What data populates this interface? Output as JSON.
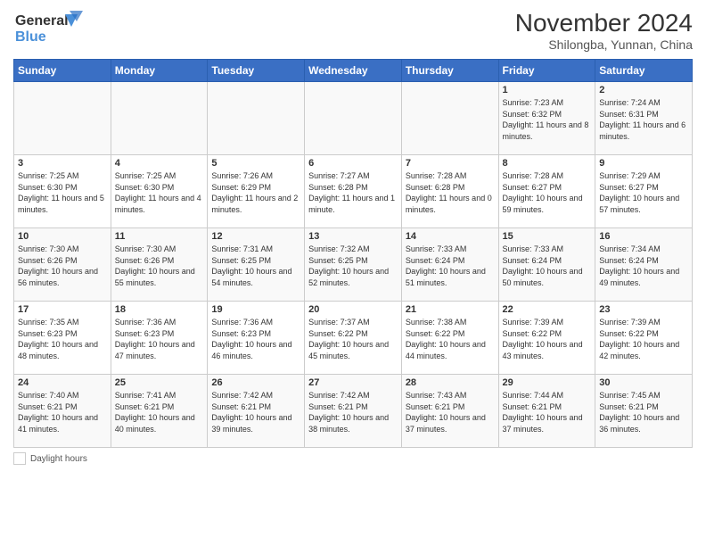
{
  "logo": {
    "line1": "General",
    "line2": "Blue"
  },
  "title": "November 2024",
  "subtitle": "Shilongba, Yunnan, China",
  "days_of_week": [
    "Sunday",
    "Monday",
    "Tuesday",
    "Wednesday",
    "Thursday",
    "Friday",
    "Saturday"
  ],
  "legend_label": "Daylight hours",
  "weeks": [
    [
      {
        "day": "",
        "info": ""
      },
      {
        "day": "",
        "info": ""
      },
      {
        "day": "",
        "info": ""
      },
      {
        "day": "",
        "info": ""
      },
      {
        "day": "",
        "info": ""
      },
      {
        "day": "1",
        "info": "Sunrise: 7:23 AM\nSunset: 6:32 PM\nDaylight: 11 hours and 8 minutes."
      },
      {
        "day": "2",
        "info": "Sunrise: 7:24 AM\nSunset: 6:31 PM\nDaylight: 11 hours and 6 minutes."
      }
    ],
    [
      {
        "day": "3",
        "info": "Sunrise: 7:25 AM\nSunset: 6:30 PM\nDaylight: 11 hours and 5 minutes."
      },
      {
        "day": "4",
        "info": "Sunrise: 7:25 AM\nSunset: 6:30 PM\nDaylight: 11 hours and 4 minutes."
      },
      {
        "day": "5",
        "info": "Sunrise: 7:26 AM\nSunset: 6:29 PM\nDaylight: 11 hours and 2 minutes."
      },
      {
        "day": "6",
        "info": "Sunrise: 7:27 AM\nSunset: 6:28 PM\nDaylight: 11 hours and 1 minute."
      },
      {
        "day": "7",
        "info": "Sunrise: 7:28 AM\nSunset: 6:28 PM\nDaylight: 11 hours and 0 minutes."
      },
      {
        "day": "8",
        "info": "Sunrise: 7:28 AM\nSunset: 6:27 PM\nDaylight: 10 hours and 59 minutes."
      },
      {
        "day": "9",
        "info": "Sunrise: 7:29 AM\nSunset: 6:27 PM\nDaylight: 10 hours and 57 minutes."
      }
    ],
    [
      {
        "day": "10",
        "info": "Sunrise: 7:30 AM\nSunset: 6:26 PM\nDaylight: 10 hours and 56 minutes."
      },
      {
        "day": "11",
        "info": "Sunrise: 7:30 AM\nSunset: 6:26 PM\nDaylight: 10 hours and 55 minutes."
      },
      {
        "day": "12",
        "info": "Sunrise: 7:31 AM\nSunset: 6:25 PM\nDaylight: 10 hours and 54 minutes."
      },
      {
        "day": "13",
        "info": "Sunrise: 7:32 AM\nSunset: 6:25 PM\nDaylight: 10 hours and 52 minutes."
      },
      {
        "day": "14",
        "info": "Sunrise: 7:33 AM\nSunset: 6:24 PM\nDaylight: 10 hours and 51 minutes."
      },
      {
        "day": "15",
        "info": "Sunrise: 7:33 AM\nSunset: 6:24 PM\nDaylight: 10 hours and 50 minutes."
      },
      {
        "day": "16",
        "info": "Sunrise: 7:34 AM\nSunset: 6:24 PM\nDaylight: 10 hours and 49 minutes."
      }
    ],
    [
      {
        "day": "17",
        "info": "Sunrise: 7:35 AM\nSunset: 6:23 PM\nDaylight: 10 hours and 48 minutes."
      },
      {
        "day": "18",
        "info": "Sunrise: 7:36 AM\nSunset: 6:23 PM\nDaylight: 10 hours and 47 minutes."
      },
      {
        "day": "19",
        "info": "Sunrise: 7:36 AM\nSunset: 6:23 PM\nDaylight: 10 hours and 46 minutes."
      },
      {
        "day": "20",
        "info": "Sunrise: 7:37 AM\nSunset: 6:22 PM\nDaylight: 10 hours and 45 minutes."
      },
      {
        "day": "21",
        "info": "Sunrise: 7:38 AM\nSunset: 6:22 PM\nDaylight: 10 hours and 44 minutes."
      },
      {
        "day": "22",
        "info": "Sunrise: 7:39 AM\nSunset: 6:22 PM\nDaylight: 10 hours and 43 minutes."
      },
      {
        "day": "23",
        "info": "Sunrise: 7:39 AM\nSunset: 6:22 PM\nDaylight: 10 hours and 42 minutes."
      }
    ],
    [
      {
        "day": "24",
        "info": "Sunrise: 7:40 AM\nSunset: 6:21 PM\nDaylight: 10 hours and 41 minutes."
      },
      {
        "day": "25",
        "info": "Sunrise: 7:41 AM\nSunset: 6:21 PM\nDaylight: 10 hours and 40 minutes."
      },
      {
        "day": "26",
        "info": "Sunrise: 7:42 AM\nSunset: 6:21 PM\nDaylight: 10 hours and 39 minutes."
      },
      {
        "day": "27",
        "info": "Sunrise: 7:42 AM\nSunset: 6:21 PM\nDaylight: 10 hours and 38 minutes."
      },
      {
        "day": "28",
        "info": "Sunrise: 7:43 AM\nSunset: 6:21 PM\nDaylight: 10 hours and 37 minutes."
      },
      {
        "day": "29",
        "info": "Sunrise: 7:44 AM\nSunset: 6:21 PM\nDaylight: 10 hours and 37 minutes."
      },
      {
        "day": "30",
        "info": "Sunrise: 7:45 AM\nSunset: 6:21 PM\nDaylight: 10 hours and 36 minutes."
      }
    ]
  ]
}
